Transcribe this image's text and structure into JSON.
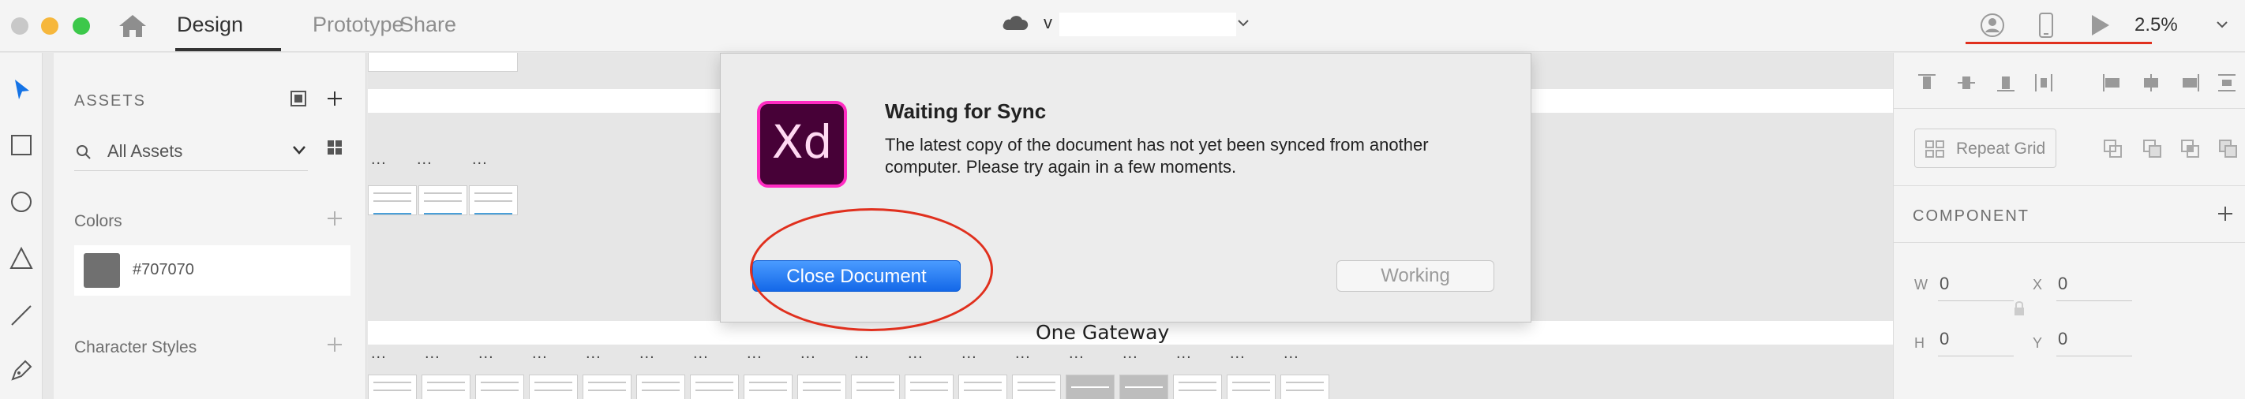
{
  "topbar": {
    "tabs": [
      "Design",
      "Prototype",
      "Share"
    ],
    "doc_name_initial": "v",
    "zoom": "2.5%"
  },
  "assets": {
    "title": "ASSETS",
    "filter": "All Assets",
    "colors_label": "Colors",
    "color_swatch": {
      "hex": "#707070",
      "label": "#707070"
    },
    "character_styles_label": "Character Styles"
  },
  "canvas": {
    "artboard_group_title": "One Gateway",
    "dots": "..."
  },
  "dialog": {
    "title": "Waiting for Sync",
    "message": "The latest copy of the document has not yet been synced from another computer. Please try again in a few moments.",
    "logo_text": "Xd",
    "primary_button": "Close Document",
    "secondary_button": "Working"
  },
  "properties": {
    "repeat_grid": "Repeat Grid",
    "component_label": "COMPONENT",
    "w_label": "W",
    "w_value": "0",
    "x_label": "X",
    "x_value": "0",
    "h_label": "H",
    "h_value": "0",
    "y_label": "Y",
    "y_value": "0"
  },
  "colors": {
    "accent_blue": "#1473e6",
    "annotation_red": "#e0301e",
    "xd_brand": "#ff2bc2"
  }
}
